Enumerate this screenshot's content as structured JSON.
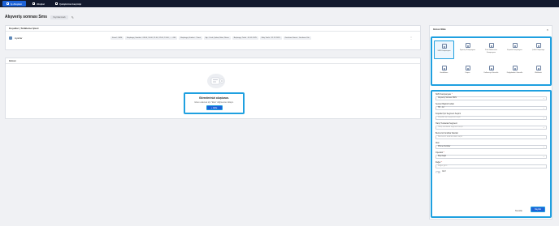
{
  "topbar": {
    "tabs": [
      {
        "label": "İş Akışları",
        "active": true
      },
      {
        "label": "Akışlar",
        "active": false
      },
      {
        "label": "Çalıştırma Geçmişi",
        "active": false
      }
    ]
  },
  "page": {
    "title": "Alışveriş sonrası Sms",
    "status": "Yayınlanmadı"
  },
  "conditions": {
    "header": "Koşullar | Tetikleme İşlevi",
    "row": {
      "name": "Ayarlar",
      "chips": [
        "Kanal : SMS",
        "Başlangıç Saatleri : 09:00, 10:00, 11:00, 12:00, 13:00, ... +105",
        "Başlangıç Günleri : Tümü",
        "Ay : Ocak, Şubat, Mart, Nisan",
        "Başlangıç Tarihi : 01.01.2025",
        "Bitiş Tarihi : 31.12.2025",
        "Gecikme Süresi : Gecikme Yok"
      ]
    }
  },
  "tasks": {
    "header": "Görev",
    "empty_title": "Görevlerinizi oluşturun.",
    "empty_subtitle": "Görev eklemek için \"Ekle\" düğmesine tıklayın.",
    "add_button": "Ekle"
  },
  "panel": {
    "title": "Görev Ekle",
    "actions": [
      {
        "label": "SMS Kampanyası",
        "icon": "sms-icon",
        "selected": true
      },
      {
        "label": "Ziyaretçi Kampanyası",
        "icon": "visitor-icon",
        "selected": false
      },
      {
        "label": "Push Notification Kampanyası",
        "icon": "push-icon",
        "selected": false
      },
      {
        "label": "E-posta Kampanyası",
        "icon": "email-icon",
        "selected": false
      },
      {
        "label": "Çoklu Kampanya",
        "icon": "multi-icon",
        "selected": false
      },
      {
        "label": "Hedefleme",
        "icon": "target-icon",
        "selected": false
      },
      {
        "label": "Kupon",
        "icon": "coupon-icon",
        "selected": false
      },
      {
        "label": "Kullanıcıyı Güncelle",
        "icon": "user-update-icon",
        "selected": false
      },
      {
        "label": "Değişkenleri Güncelle",
        "icon": "variables-icon",
        "selected": false
      },
      {
        "label": "Webhook",
        "icon": "webhook-icon",
        "selected": false
      }
    ],
    "form": {
      "campaign_label": "SMS Kampanyası",
      "campaign_value": "Alışveriş Sonrası SMS",
      "sender_label": "Sender Başlık Kodları",
      "sender_value": "TR - 12",
      "segment_label": "Koşullar İçin Segment Seçimi",
      "segment_placeholder": "Koşullar için segment seçin",
      "exclude_label": "Hariç Tutulacak Segment",
      "exclude_placeholder": "Hariç tutulacak segment seçin",
      "keys_label": "Benzersiz Anahtar Alanları",
      "keys_placeholder": "Benzersiz anahtar alanı seçin",
      "field_label": "Alan",
      "field_value": "Phone Number",
      "operator_label": "Operatör",
      "operator_value": "Boş Değil",
      "value_label": "Değer",
      "value_placeholder": "Değer girin",
      "toggle_label": "Aktif",
      "cancel": "Temizle",
      "save": "Kaydet"
    }
  }
}
